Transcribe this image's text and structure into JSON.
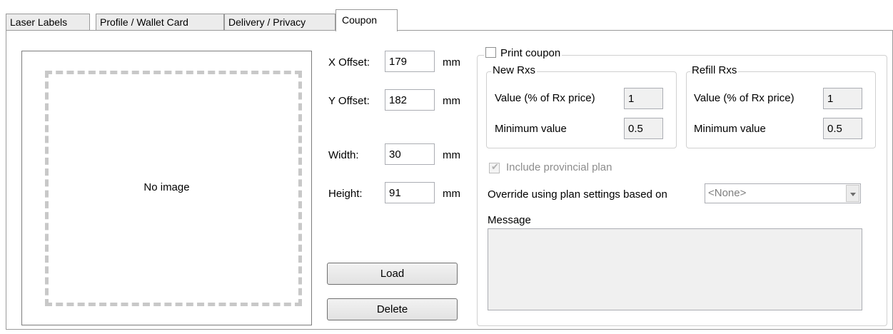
{
  "tabs": [
    {
      "label": "Laser Labels"
    },
    {
      "label": "Profile / Wallet Card"
    },
    {
      "label": "Delivery / Privacy"
    },
    {
      "label": "Coupon"
    }
  ],
  "image_panel": {
    "no_image_text": "No image"
  },
  "offsets": {
    "x_label": "X Offset:",
    "x_value": "179",
    "x_unit": "mm",
    "y_label": "Y Offset:",
    "y_value": "182",
    "y_unit": "mm",
    "width_label": "Width:",
    "width_value": "30",
    "width_unit": "mm",
    "height_label": "Height:",
    "height_value": "91",
    "height_unit": "mm"
  },
  "buttons": {
    "load": "Load",
    "delete": "Delete"
  },
  "coupon": {
    "print_coupon_label": "Print coupon",
    "print_coupon_checked": false,
    "new_rxs": {
      "title": "New Rxs",
      "value_label": "Value (% of Rx price)",
      "value": "1",
      "min_label": "Minimum value",
      "min_value": "0.5"
    },
    "refill_rxs": {
      "title": "Refill Rxs",
      "value_label": "Value (% of Rx price)",
      "value": "1",
      "min_label": "Minimum value",
      "min_value": "0.5"
    },
    "include_provincial_label": "Include provincial plan",
    "include_provincial_checked": true,
    "override_label": "Override using plan settings based on",
    "override_value": "<None>",
    "message_label": "Message",
    "message_value": ""
  }
}
